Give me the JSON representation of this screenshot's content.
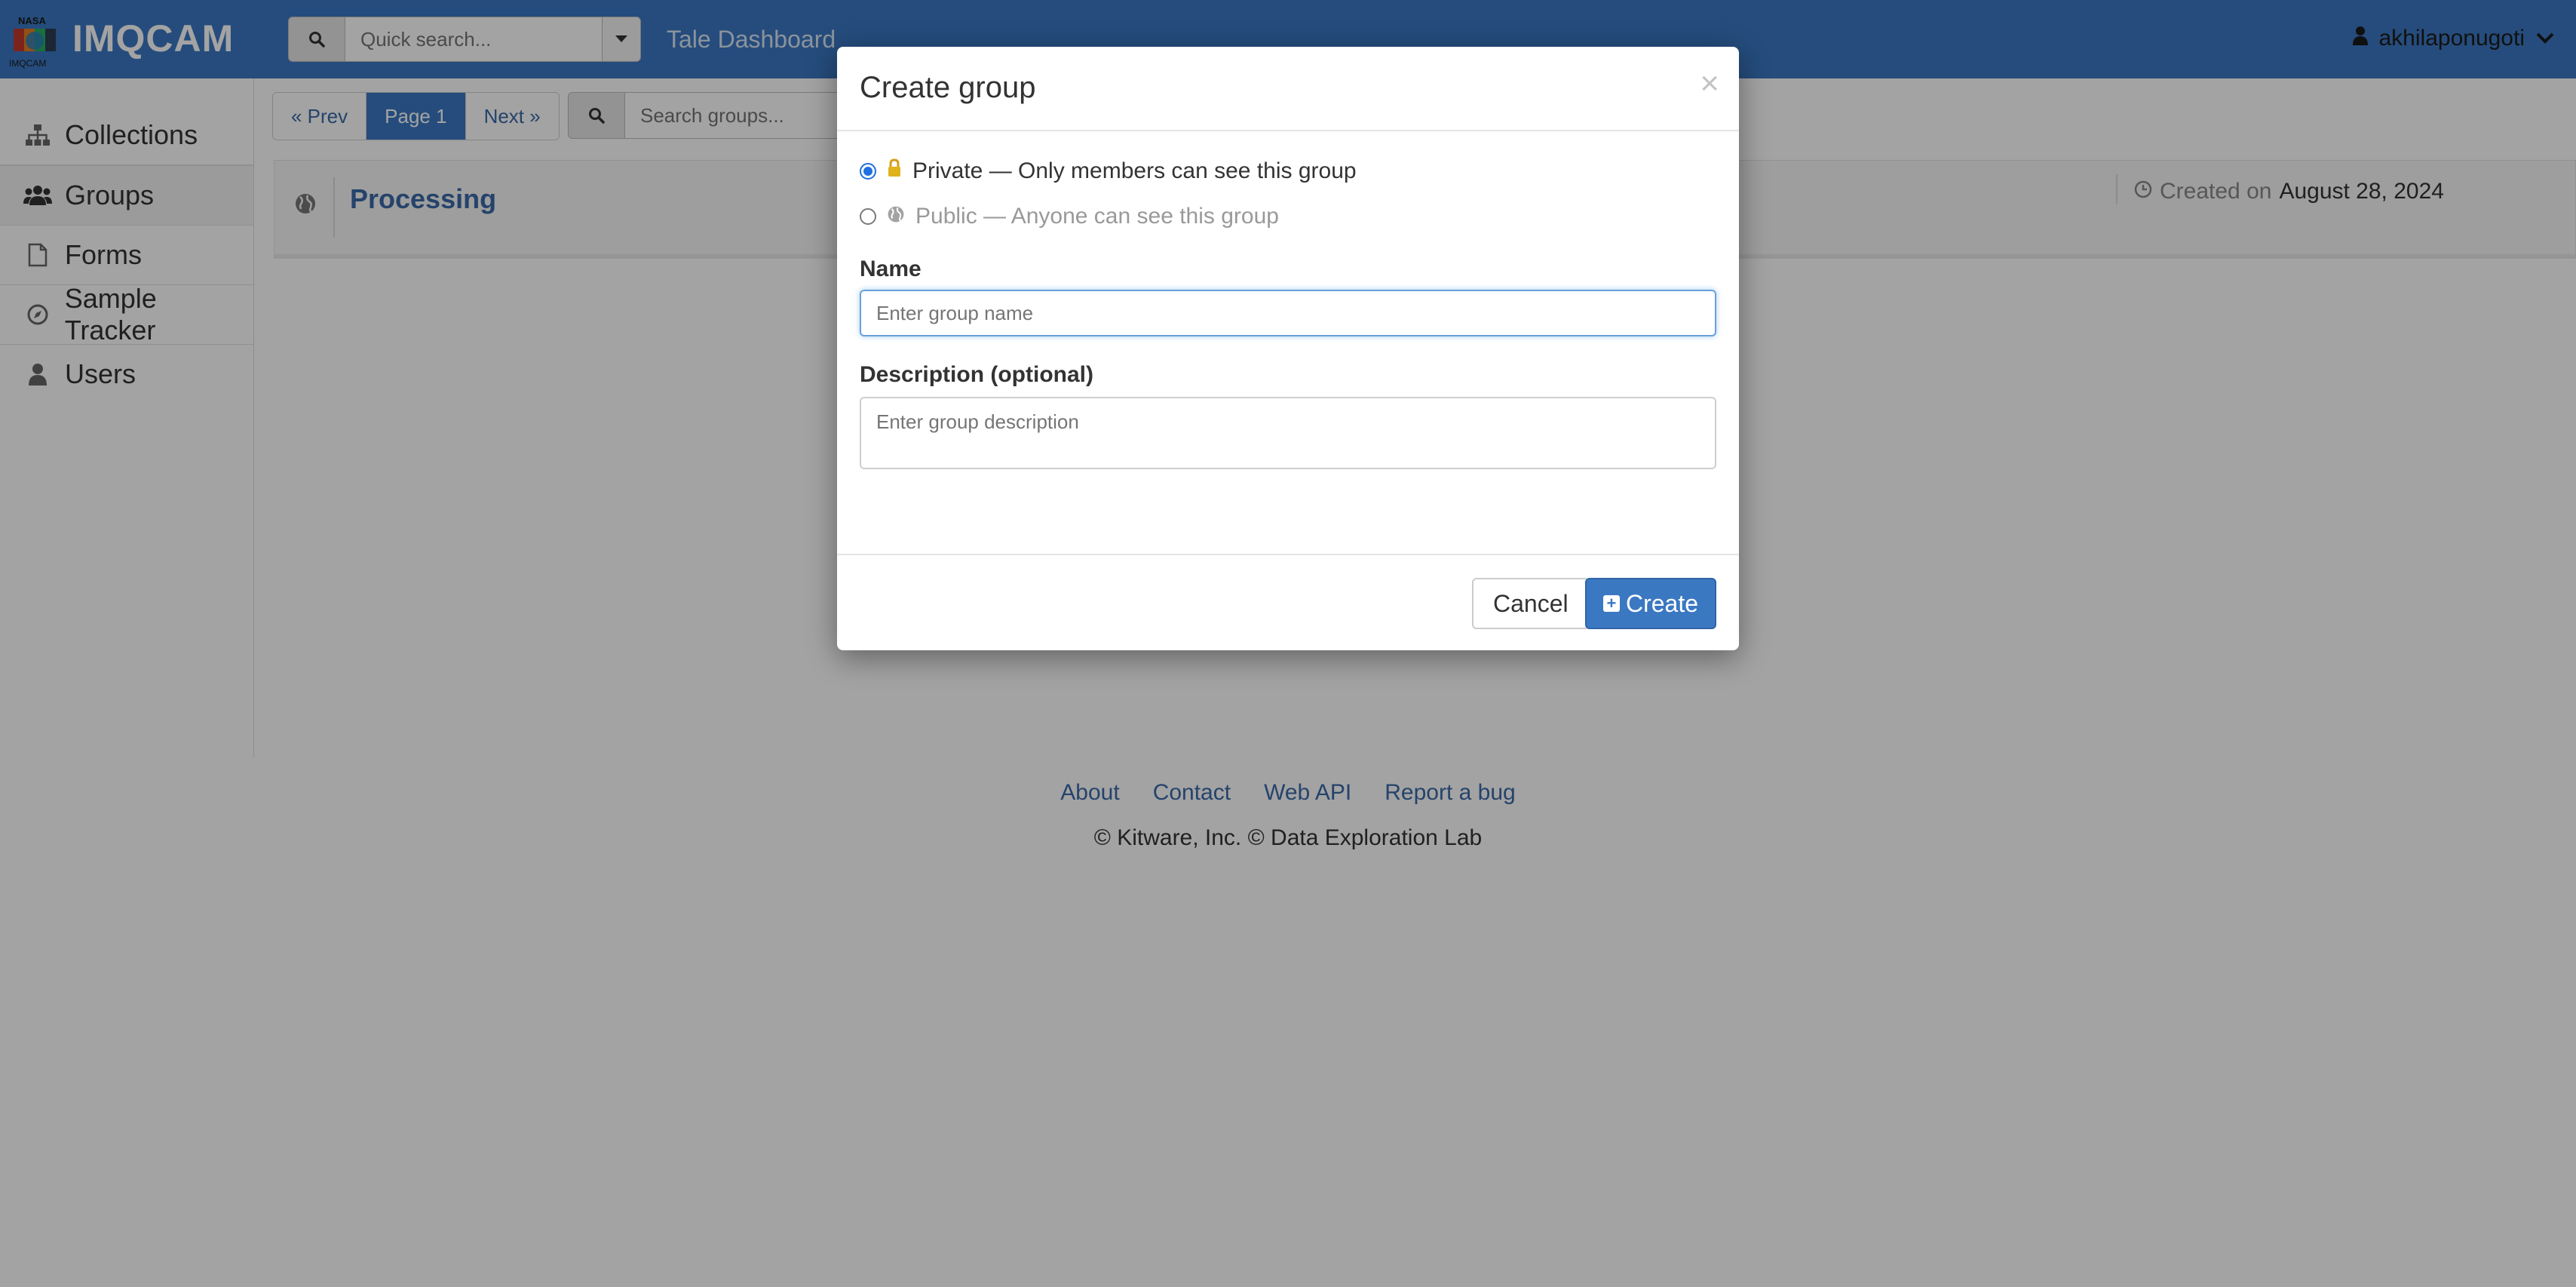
{
  "header": {
    "logo_small": "IMQCAM",
    "logo_text": "IMQCAM",
    "quick_search_placeholder": "Quick search...",
    "tale_dashboard": "Tale Dashboard",
    "username": "akhilaponugoti"
  },
  "sidebar": {
    "items": [
      {
        "label": "Collections",
        "icon": "sitemap-icon"
      },
      {
        "label": "Groups",
        "icon": "users-icon",
        "active": true
      },
      {
        "label": "Forms",
        "icon": "file-icon"
      },
      {
        "label": "Sample Tracker",
        "icon": "compass-icon"
      },
      {
        "label": "Users",
        "icon": "user-icon"
      }
    ]
  },
  "pager": {
    "prev": "« Prev",
    "current": "Page 1",
    "next": "Next »"
  },
  "group_search_placeholder": "Search groups...",
  "groups": [
    {
      "name": "Processing",
      "created_label": "Created on",
      "created_date": "August 28, 2024"
    }
  ],
  "footer": {
    "links": [
      "About",
      "Contact",
      "Web API",
      "Report a bug"
    ],
    "copyright": "© Kitware, Inc. © Data Exploration Lab"
  },
  "modal": {
    "title": "Create group",
    "close": "×",
    "private_label": "Private — Only members can see this group",
    "public_label": "Public — Anyone can see this group",
    "name_label": "Name",
    "name_placeholder": "Enter group name",
    "description_label": "Description (optional)",
    "description_placeholder": "Enter group description",
    "cancel": "Cancel",
    "create": "Create"
  },
  "colors": {
    "header_bg": "#3b78c2",
    "link": "#3a6aa8",
    "primary_button": "#3b78c2"
  }
}
